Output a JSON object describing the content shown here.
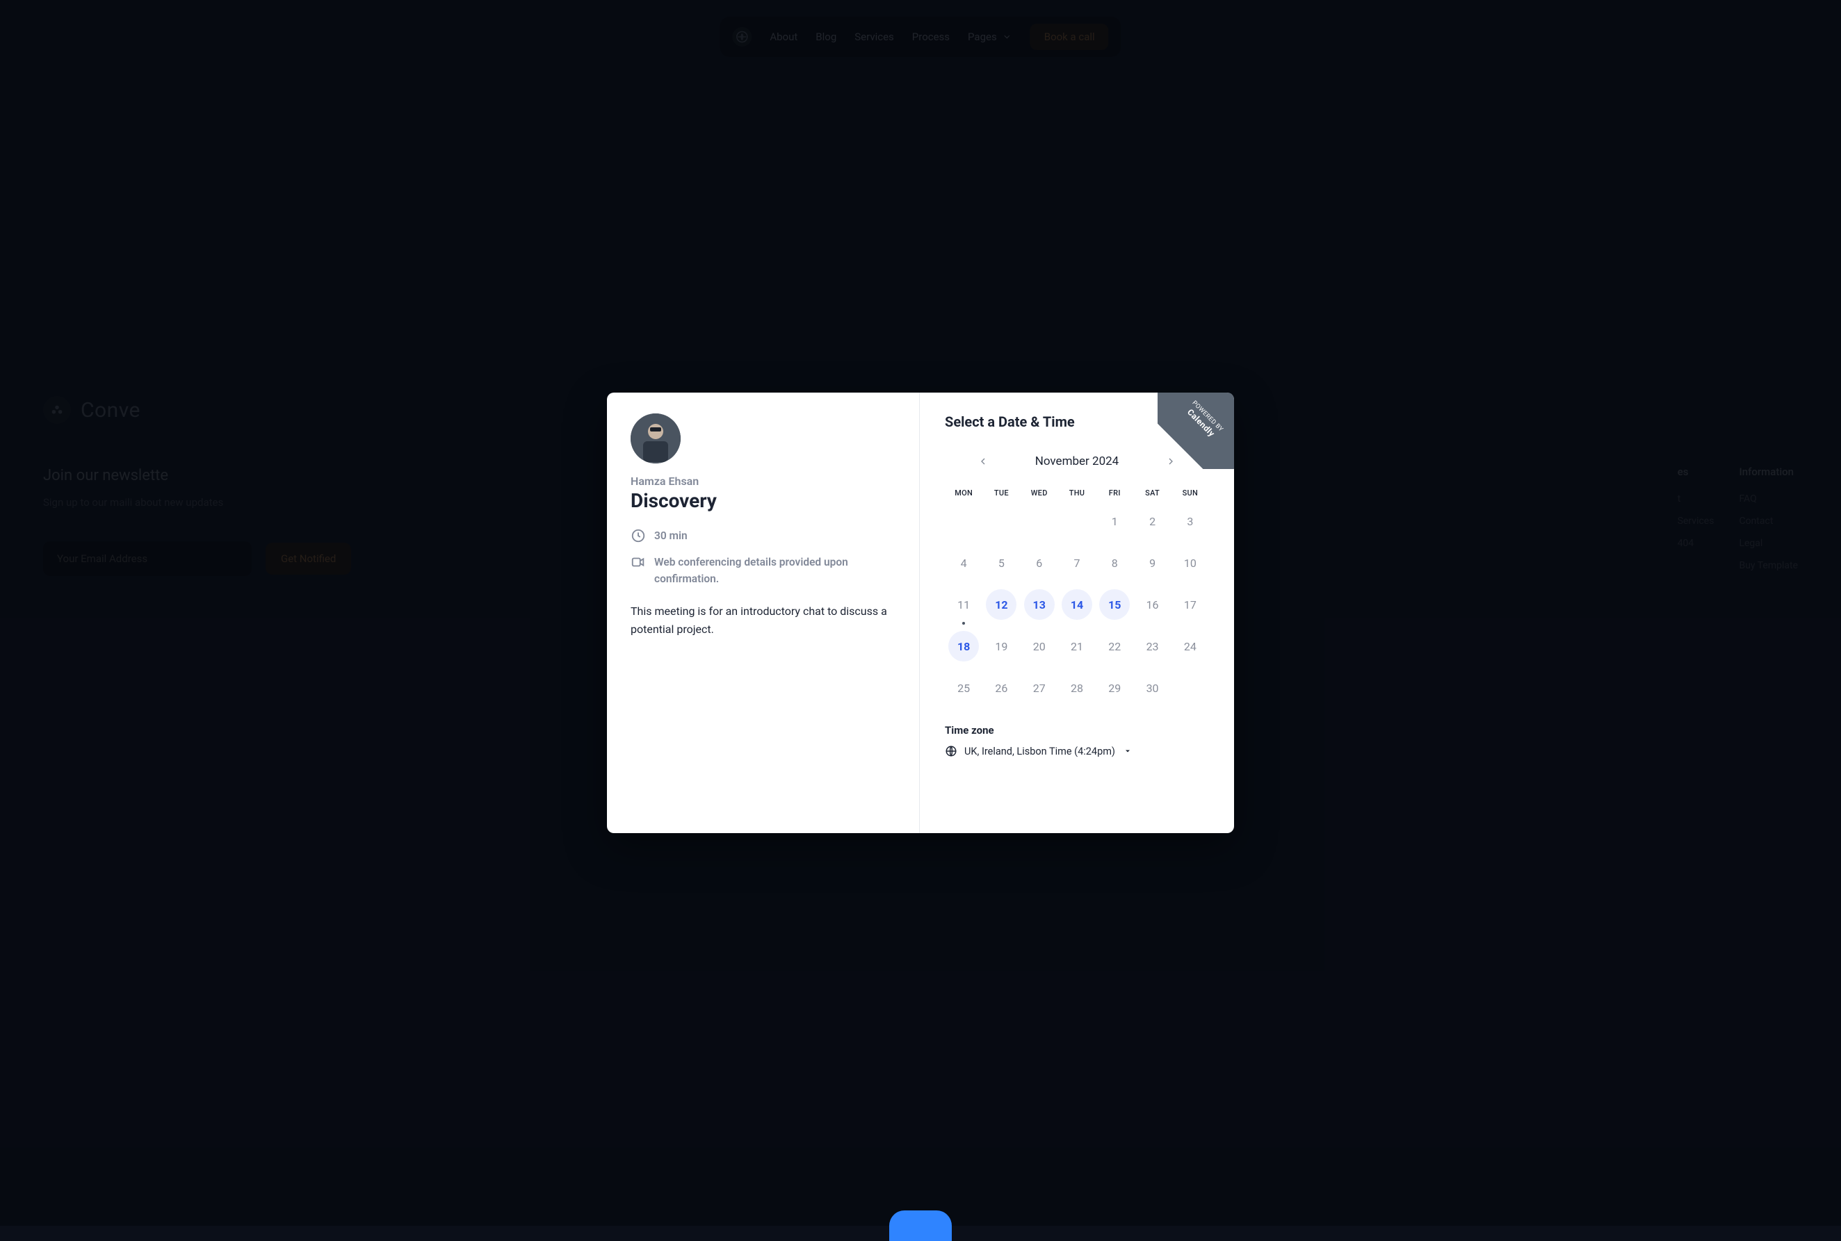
{
  "nav": {
    "items": [
      "About",
      "Blog",
      "Services",
      "Process"
    ],
    "pages_label": "Pages",
    "cta": "Book a call"
  },
  "footer": {
    "brand": "Conve",
    "newsletter_title": "Join our newslette",
    "newsletter_sub": "Sign up to our maili\nabout new updates",
    "email_placeholder": "Your Email Address",
    "notify": "Get Notified",
    "col1": {
      "title": "es",
      "items": [
        "t",
        "Services",
        "404"
      ]
    },
    "col2": {
      "title": "Information",
      "items": [
        "FAQ",
        "Contact",
        "Legal",
        "Buy Template"
      ]
    }
  },
  "modal": {
    "host": "Hamza Ehsan",
    "event": "Discovery",
    "duration": "30 min",
    "location": "Web conferencing details provided upon confirmation.",
    "description": "This meeting is for an introductory chat to discuss a potential project.",
    "select_title": "Select a Date & Time",
    "powered_small": "POWERED BY",
    "powered_big": "Calendly",
    "month": "November 2024",
    "dow": [
      "MON",
      "TUE",
      "WED",
      "THU",
      "FRI",
      "SAT",
      "SUN"
    ],
    "days": [
      {
        "n": "",
        "t": "blank"
      },
      {
        "n": "",
        "t": "blank"
      },
      {
        "n": "",
        "t": "blank"
      },
      {
        "n": "",
        "t": "blank"
      },
      {
        "n": "1",
        "t": "dis"
      },
      {
        "n": "2",
        "t": "dis"
      },
      {
        "n": "3",
        "t": "dis"
      },
      {
        "n": "4",
        "t": "dis"
      },
      {
        "n": "5",
        "t": "dis"
      },
      {
        "n": "6",
        "t": "dis"
      },
      {
        "n": "7",
        "t": "dis"
      },
      {
        "n": "8",
        "t": "dis"
      },
      {
        "n": "9",
        "t": "dis"
      },
      {
        "n": "10",
        "t": "dis"
      },
      {
        "n": "11",
        "t": "today"
      },
      {
        "n": "12",
        "t": "avail"
      },
      {
        "n": "13",
        "t": "avail"
      },
      {
        "n": "14",
        "t": "avail"
      },
      {
        "n": "15",
        "t": "avail"
      },
      {
        "n": "16",
        "t": "dis"
      },
      {
        "n": "17",
        "t": "dis"
      },
      {
        "n": "18",
        "t": "avail"
      },
      {
        "n": "19",
        "t": "dis"
      },
      {
        "n": "20",
        "t": "dis"
      },
      {
        "n": "21",
        "t": "dis"
      },
      {
        "n": "22",
        "t": "dis"
      },
      {
        "n": "23",
        "t": "dis"
      },
      {
        "n": "24",
        "t": "dis"
      },
      {
        "n": "25",
        "t": "dis"
      },
      {
        "n": "26",
        "t": "dis"
      },
      {
        "n": "27",
        "t": "dis"
      },
      {
        "n": "28",
        "t": "dis"
      },
      {
        "n": "29",
        "t": "dis"
      },
      {
        "n": "30",
        "t": "dis"
      }
    ],
    "tz_label": "Time zone",
    "tz_value": "UK, Ireland, Lisbon Time (4:24pm)"
  }
}
